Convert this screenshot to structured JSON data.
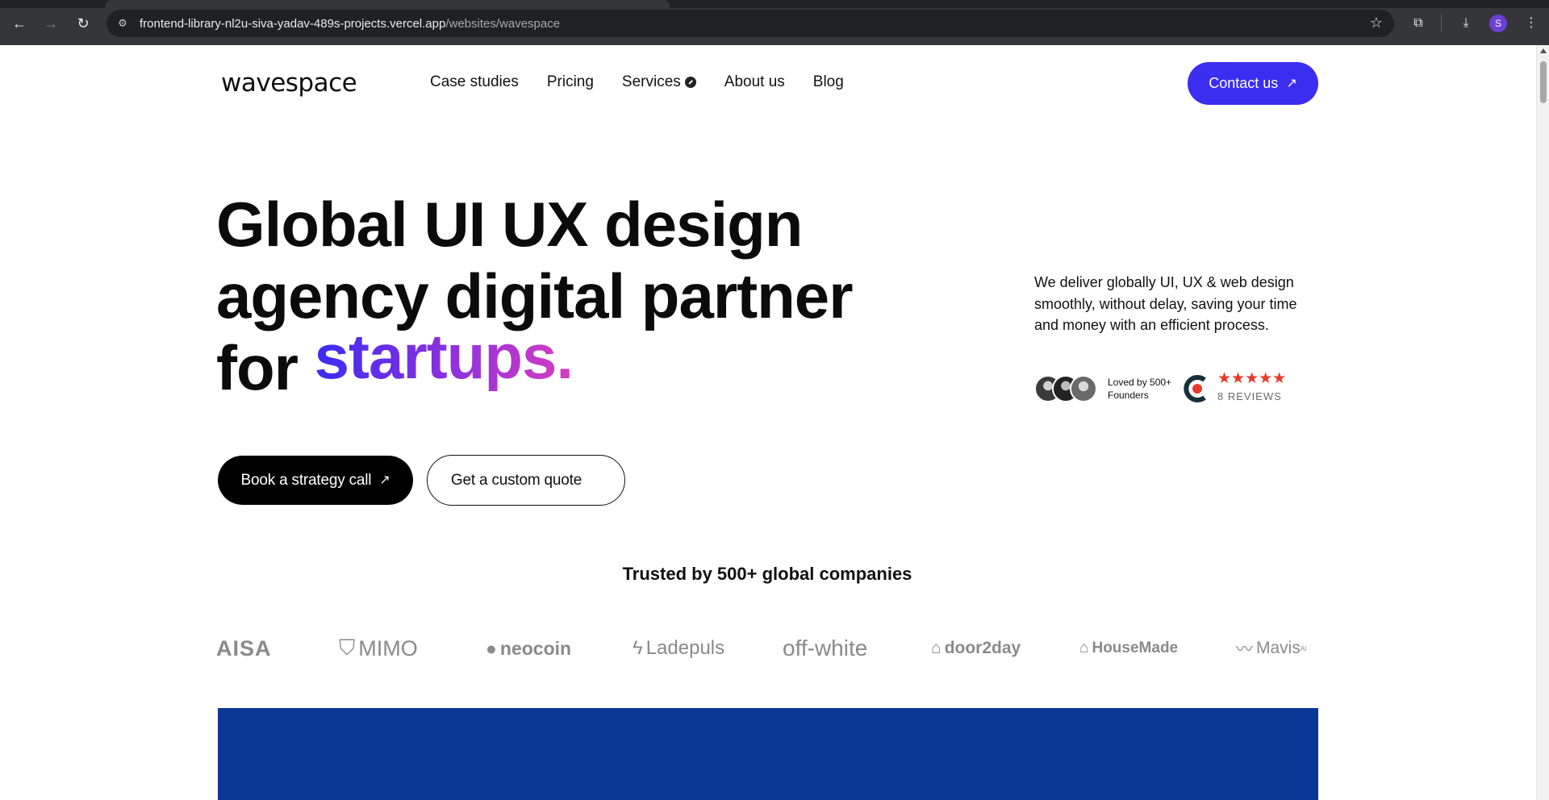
{
  "browser": {
    "url_host": "frontend-library-nl2u-siva-yadav-489s-projects.vercel.app",
    "url_path": "/websites/wavespace",
    "profile_initial": "S"
  },
  "header": {
    "logo": "wavespace",
    "nav": [
      "Case studies",
      "Pricing",
      "Services",
      "About us",
      "Blog"
    ],
    "contact_label": "Contact us"
  },
  "hero": {
    "title_line1": "Global UI UX design",
    "title_line2": "agency digital partner",
    "title_line3_prefix": "for",
    "title_highlight": "startups.",
    "description": "We deliver globally UI, UX & web design smoothly, without delay, saving your time and money with an efficient process.",
    "loved_line1": "Loved by 500+",
    "loved_line2": "Founders",
    "stars": "★★★★★",
    "reviews": "8 REVIEWS",
    "primary_cta": "Book a strategy call",
    "secondary_cta": "Get a custom quote"
  },
  "trusted": {
    "heading": "Trusted by 500+ global companies",
    "brands": [
      "AISA",
      "MIMO",
      "neocoin",
      "Ladepuls",
      "off-white",
      "door2day",
      "HouseMade",
      "Mavis"
    ],
    "mavis_suffix": "AI"
  },
  "colors": {
    "accent": "#3b2ef0",
    "panel": "#0b3796",
    "star": "#e8392a"
  }
}
